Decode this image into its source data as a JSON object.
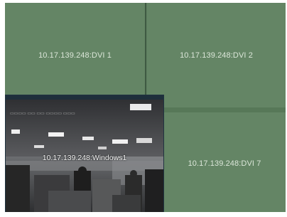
{
  "video_wall": {
    "tiles": [
      {
        "label": "10.17.139.248:DVI 1"
      },
      {
        "label": "10.17.139.248:DVI 2"
      },
      {
        "label": "10.17.139.248:DVI 7"
      }
    ],
    "window": {
      "title": "10.17.139.248:Windows1"
    }
  },
  "colors": {
    "tile_background": "#648565",
    "window_border": "#203340",
    "label_text": "#e6efe3"
  }
}
